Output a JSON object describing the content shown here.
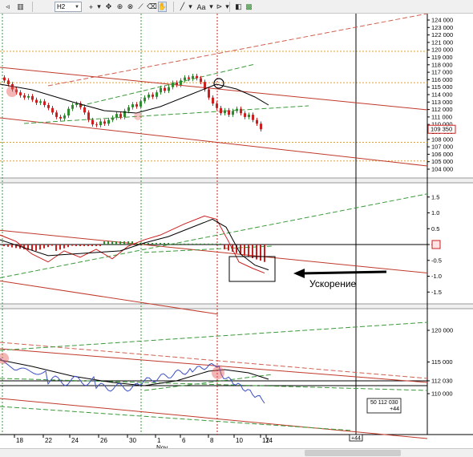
{
  "toolbar": {
    "timeframe": "H2",
    "tools": [
      {
        "name": "tool-arrow-icon",
        "glyph": "◃"
      },
      {
        "name": "tool-bars-icon",
        "glyph": "▥"
      },
      {
        "name": "crosshair-icon",
        "glyph": "+"
      },
      {
        "name": "crosshair-dropdown-icon",
        "glyph": "▾"
      },
      {
        "name": "move-icon",
        "glyph": "✥"
      },
      {
        "name": "zoom-in-icon",
        "glyph": "⊕"
      },
      {
        "name": "zoom-out-icon",
        "glyph": "⊗"
      },
      {
        "name": "ruler-icon",
        "glyph": "⟋"
      },
      {
        "name": "eraser-icon",
        "glyph": "⌫"
      },
      {
        "name": "hand-icon",
        "glyph": "✋"
      },
      {
        "name": "line-tool-icon",
        "glyph": "╱"
      },
      {
        "name": "line-dropdown-icon",
        "glyph": "▾"
      },
      {
        "name": "text-tool-icon",
        "glyph": "Aa"
      },
      {
        "name": "text-dropdown-icon",
        "glyph": "▾"
      },
      {
        "name": "marker-icon",
        "glyph": "⊳"
      },
      {
        "name": "marker-dropdown-icon",
        "glyph": "▾"
      },
      {
        "name": "pattern-icon",
        "glyph": "◧"
      },
      {
        "name": "object-list-icon",
        "glyph": "▩"
      }
    ]
  },
  "panes": {
    "price": {
      "axis_labels": [
        "124 000",
        "123 000",
        "122 000",
        "121 000",
        "120 000",
        "119 000",
        "118 000",
        "117 000",
        "116 000",
        "115 000",
        "114 000",
        "113 000",
        "112 000",
        "111 000",
        "110 000",
        "109 000",
        "108 000",
        "107 000",
        "106 000",
        "105 000",
        "104 000"
      ],
      "current_price": "109 350"
    },
    "oscillator": {
      "axis_labels": [
        "1.5",
        "1.0",
        "0.5",
        "0",
        "-0.5",
        "-1.0",
        "-1.5"
      ]
    },
    "lower": {
      "axis_labels": [
        "120 000",
        "115 000",
        "112 030",
        "110 000"
      ],
      "info_line1": "50   112 030",
      "info_line2": "+44"
    }
  },
  "annotation": {
    "text": "Ускорение"
  },
  "time_axis": {
    "labels": [
      "18",
      "22",
      "24",
      "26",
      "30",
      "1",
      "6",
      "8",
      "10",
      "12",
      "14"
    ],
    "month_label": "Nov",
    "cursor_badge": "+44"
  },
  "colors": {
    "bull": "#2e8b2e",
    "bear": "#cc1f1f",
    "red_line": "#c0392b",
    "green_dash": "#3a9a3a",
    "ma_black": "#000000",
    "blue_line": "#3b4fc4",
    "level_orange": "#e0a030"
  }
}
